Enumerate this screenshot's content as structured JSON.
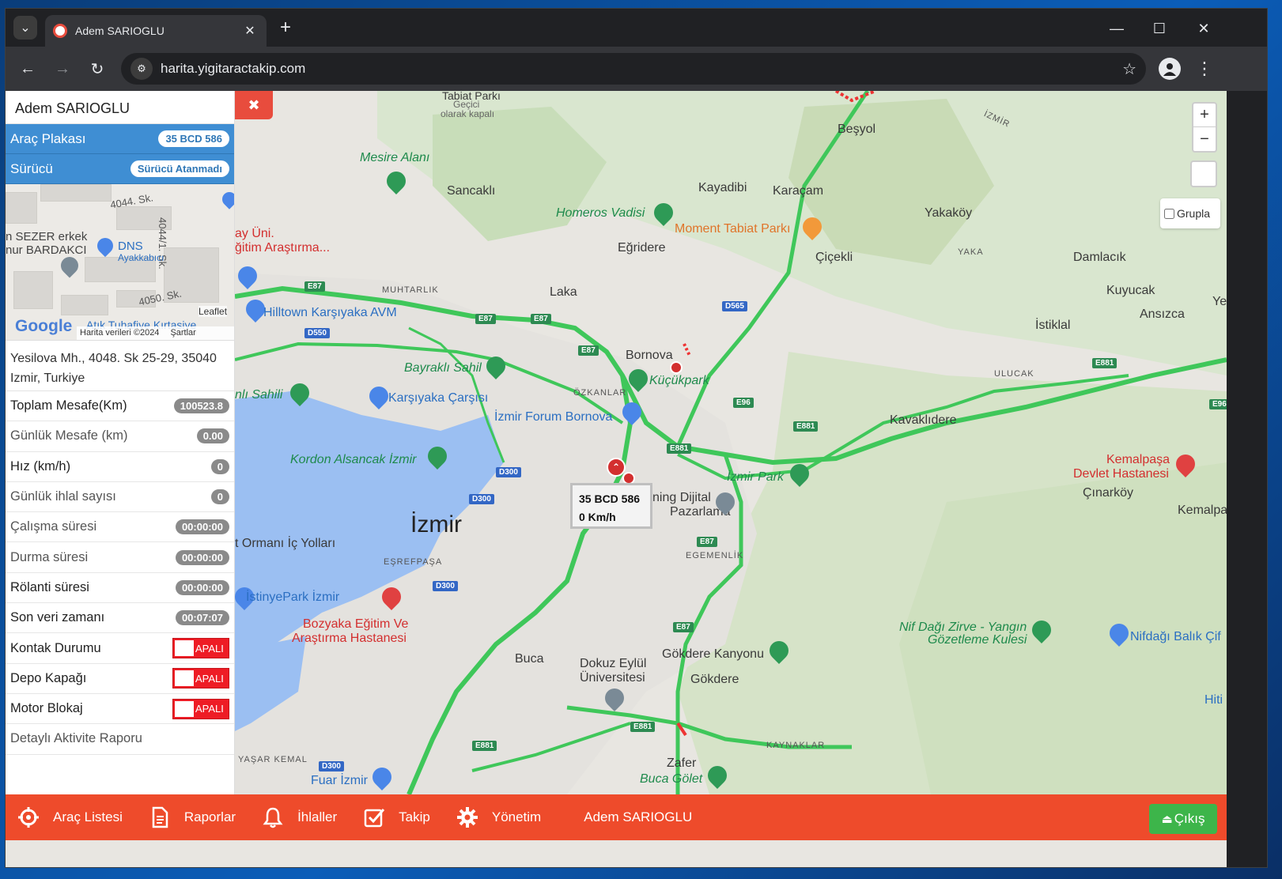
{
  "browser": {
    "tab_title": "Adem SARIOGLU",
    "url": "harita.yigitaractakip.com",
    "icons": [
      "tab-search-icon",
      "favicon-icon",
      "close-tab-icon",
      "new-tab-icon",
      "minimize-icon",
      "maximize-icon",
      "close-window-icon",
      "back-icon",
      "forward-icon",
      "reload-icon",
      "site-settings-icon",
      "bookmark-star-icon",
      "profile-icon",
      "menu-icon"
    ]
  },
  "panel": {
    "user_name": "Adem SARIOGLU",
    "plate_label": "Araç Plakası",
    "plate_value": "35 BCD 586",
    "driver_label": "Sürücü",
    "driver_value": "Sürücü Atanmadı",
    "minimap": {
      "streets": [
        "4044. Sk.",
        "4044/1. Sk.",
        "4050. Sk."
      ],
      "places": [
        "n SEZER erkek",
        "nur BARDAKCI",
        "DNS",
        "Ayakkabıcı",
        "Atık Tuhafiye Kırtasiye"
      ],
      "leaflet": "Leaflet",
      "copyright": "Harita verileri ©2024",
      "terms": "Şartlar",
      "google": "Google"
    },
    "address": "Yesilova Mh., 4048. Sk 25-29, 35040 Izmir, Turkiye",
    "rows": [
      {
        "label": "Toplam Mesafe(Km)",
        "value": "100523.8"
      },
      {
        "label": "Günlük Mesafe (km)",
        "value": "0.00"
      },
      {
        "label": "Hız (km/h)",
        "value": "0"
      },
      {
        "label": "Günlük ihlal sayısı",
        "value": "0"
      },
      {
        "label": "Çalışma süresi",
        "value": "00:00:00"
      },
      {
        "label": "Durma süresi",
        "value": "00:00:00"
      },
      {
        "label": "Rölanti süresi",
        "value": "00:00:00"
      },
      {
        "label": "Son veri zamanı",
        "value": "00:07:07"
      }
    ],
    "toggles": [
      {
        "label": "Kontak Durumu",
        "value": "APALI"
      },
      {
        "label": "Depo Kapağı",
        "value": "APALI"
      },
      {
        "label": "Motor Blokaj",
        "value": "APALI"
      }
    ],
    "report_link": "Detaylı Aktivite Raporu"
  },
  "map": {
    "close_icon": "close-icon",
    "zoom_in": "+",
    "zoom_out": "−",
    "grupla_label": "Grupla",
    "vehicle_plate": "35 BCD 586",
    "vehicle_speed": "0 Km/h",
    "labels": {
      "izmir": "İzmir",
      "besyol": "Beşyol",
      "izmir_road": "İZMİR",
      "mesire": "Mesire Alanı",
      "sancakli": "Sancaklı",
      "kayadibi": "Kayadibi",
      "karacam": "Karaçam",
      "yakakoy": "Yakaköy",
      "homeros": "Homeros Vadisi",
      "moment": "Moment Tabiat Parkı",
      "egridere": "Eğridere",
      "cicekli": "Çiçekli",
      "damlacik": "Damlacık",
      "yaka": "YAKA",
      "kuyucak": "Kuyucak",
      "ansizca": "Ansızca",
      "istiklal": "İstiklal",
      "muhtarlik": "MUHTARLIK",
      "laka": "Laka",
      "hilltown": "Hilltown Karşıyaka AVM",
      "bornova": "Bornova",
      "kucukpark": "Küçükpark",
      "bayrakli": "Bayraklı Sahil",
      "karsiyaka": "Karşıyaka Çarşısı",
      "ozkanlar": "ÖZKANLAR",
      "forum": "İzmir Forum Bornova",
      "ulucak": "ULUCAK",
      "kavaklidere": "Kavaklıdere",
      "sahili": "nlı Sahili",
      "kordon": "Kordon Alsancak İzmir",
      "izmirpark": "İzmir Park",
      "kemalpasa": "Kemalpaşa",
      "devlet": "Devlet Hastanesi",
      "cinarkoy": "Çınarköy",
      "kemalpa": "Kemalpa",
      "dijital": "ning Dijital",
      "pazarlama": "Pazarlama",
      "ormani": "t Ormanı İç Yolları",
      "esrefpasa": "EŞREFPAŞA",
      "egemenlik": "EGEMENLİK",
      "istinye": "İstinyePark İzmir",
      "bozyaka1": "Bozyaka Eğitim Ve",
      "bozyaka2": "Araştırma Hastanesi",
      "nif1": "Nif Dağı Zirve - Yangın",
      "nif2": "Gözetleme Kulesi",
      "nifbalik": "Nifdağı Balık Çif",
      "buca": "Buca",
      "dokuz1": "Dokuz Eylül",
      "dokuz2": "Üniversitesi",
      "gokdere_k": "Gökdere Kanyonu",
      "gokdere": "Gökdere",
      "kaynaklar": "KAYNAKLAR",
      "hiti": "Hiti",
      "yasar": "YAŞAR KEMAL",
      "fuar": "Fuar İzmir",
      "zafer": "Zafer",
      "bucagolet": "Buca Gölet",
      "uni": "ay Üni.",
      "arastirma": "ğitim Araştırma...",
      "tabiat": "Tabiat Parkı",
      "gecici1": "Geçici",
      "gecici2": "olarak kapalı",
      "ye": "Ye"
    },
    "shields": [
      "E87",
      "E87",
      "E87",
      "E87",
      "E87",
      "E87",
      "D550",
      "D565",
      "E881",
      "E881",
      "E881",
      "E96",
      "E96",
      "D300",
      "D300",
      "D300",
      "D300",
      "E881",
      "E881"
    ]
  },
  "bottom_nav": {
    "items": [
      {
        "label": "Araç Listesi",
        "icon": "crosshair-icon"
      },
      {
        "label": "Raporlar",
        "icon": "document-icon"
      },
      {
        "label": "İhlaller",
        "icon": "bell-icon"
      },
      {
        "label": "Takip",
        "icon": "checkbox-icon"
      },
      {
        "label": "Yönetim",
        "icon": "gear-icon"
      }
    ],
    "user": "Adem SARIOGLU",
    "exit_label": "Çıkış",
    "exit_icon": "eject-icon"
  },
  "colors": {
    "accent_red": "#ee4b2b",
    "panel_blue": "#3f8ed3",
    "exit_green": "#3db54a",
    "road_green": "#3fc75a",
    "water": "#9bbff2"
  }
}
